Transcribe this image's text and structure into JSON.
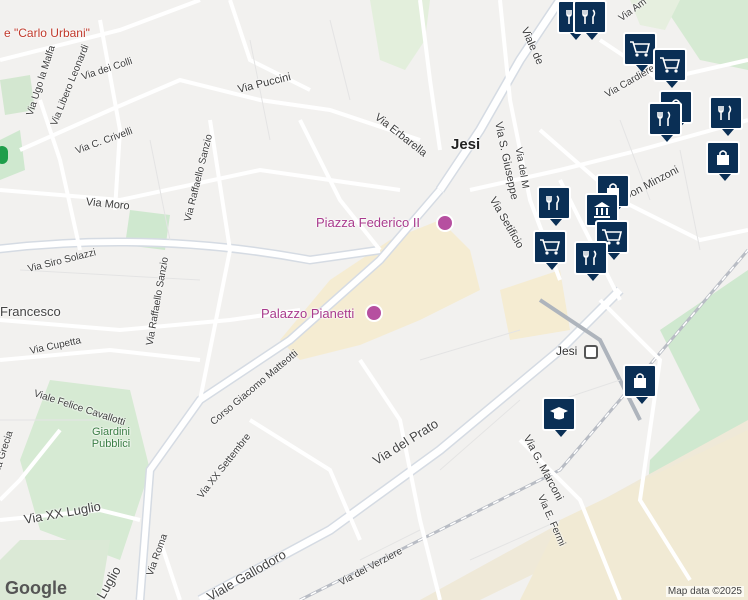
{
  "map": {
    "city_label": "Jesi",
    "street_labels": [
      {
        "text": "Via Puccini"
      },
      {
        "text": "Via Erbarella"
      },
      {
        "text": "Via Ugo la Malfa"
      },
      {
        "text": "Via dei Colli"
      },
      {
        "text": "Via Libero Leonardi"
      },
      {
        "text": "Via C. Crivelli"
      },
      {
        "text": "Via Moro"
      },
      {
        "text": "Via Raffaello Sanzio"
      },
      {
        "text": "Via Raffaello Sanzio"
      },
      {
        "text": "Via Siro Solazzi"
      },
      {
        "text": "Francesco"
      },
      {
        "text": "Via Cupetta"
      },
      {
        "text": "Viale Felice Cavallotti"
      },
      {
        "text": "Corso Giacomo Matteotti"
      },
      {
        "text": "Via XX Settembre"
      },
      {
        "text": "Via del Prato"
      },
      {
        "text": "Via XX Luglio"
      },
      {
        "text": "Via Grecia"
      },
      {
        "text": "Via Roma"
      },
      {
        "text": "Viale Gallodoro"
      },
      {
        "text": "Via del Verziere"
      },
      {
        "text": "Via S. Giuseppe"
      },
      {
        "text": "Viale de"
      },
      {
        "text": "Via del M"
      },
      {
        "text": "Via Setificio"
      },
      {
        "text": "Via Cardiere"
      },
      {
        "text": "Don Minzoni"
      },
      {
        "text": "Via Am"
      },
      {
        "text": "Via G. Marconi"
      },
      {
        "text": "Via E. Fermi"
      },
      {
        "text": "Luglio"
      }
    ],
    "poi_labels": [
      {
        "text": "Piazza Federico II"
      },
      {
        "text": "Palazzo Pianetti"
      }
    ],
    "other_labels": {
      "hospital": "e \"Carlo Urbani\"",
      "park": "Giardini Pubblici",
      "station": "Jesi"
    },
    "markers": [
      {
        "icon": "restaurant-icon"
      },
      {
        "icon": "restaurant-icon"
      },
      {
        "icon": "grocery-cart-icon"
      },
      {
        "icon": "grocery-cart-icon"
      },
      {
        "icon": "shopping-bag-icon"
      },
      {
        "icon": "restaurant-icon"
      },
      {
        "icon": "restaurant-icon"
      },
      {
        "icon": "shopping-bag-icon"
      },
      {
        "icon": "shopping-bag-icon"
      },
      {
        "icon": "restaurant-icon"
      },
      {
        "icon": "museum-icon"
      },
      {
        "icon": "grocery-cart-icon"
      },
      {
        "icon": "grocery-cart-icon"
      },
      {
        "icon": "restaurant-icon"
      },
      {
        "icon": "shopping-bag-icon"
      },
      {
        "icon": "school-icon"
      }
    ],
    "attribution": {
      "logo": "Google",
      "credit": "Map data ©2025"
    },
    "colors": {
      "land": "#f2f1ef",
      "road": "#ffffff",
      "major_road": "#d9dde3",
      "park": "#cfe8cf",
      "center": "#f5ecd2",
      "marker": "#0a2f55"
    }
  }
}
